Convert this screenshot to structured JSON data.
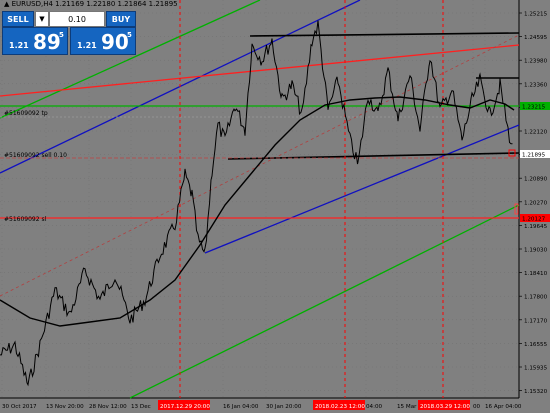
{
  "symbol_line": "EURUSD,H4  1.21169 1.22180 1.21864 1.21895",
  "trade_panel": {
    "sell_label": "SELL",
    "buy_label": "BUY",
    "lot_value": "0.10",
    "dropdown_icon": "chevron-down-icon",
    "sell_prefix": "1.21",
    "sell_big": "89",
    "sell_sup": "5",
    "buy_prefix": "1.21",
    "buy_big": "90",
    "buy_sup": "5"
  },
  "price_axis": {
    "labels": [
      "1.25215",
      "1.24595",
      "1.23980",
      "1.23360",
      "1.22745",
      "1.22120",
      "1.21505",
      "1.20890",
      "1.20270",
      "1.19645",
      "1.19030",
      "1.18410",
      "1.17800",
      "1.17170",
      "1.16555",
      "1.15935",
      "1.15320"
    ],
    "tags": [
      {
        "text": "1.23215",
        "color": "#00b000"
      },
      {
        "text": "1.21895",
        "color": "#ffffff"
      },
      {
        "text": "1.20127",
        "color": "#ff0000"
      }
    ]
  },
  "time_axis": {
    "labels": [
      "30 Oct 2017",
      "13 Nov 20:00",
      "28 Nov 12:00",
      "13 Dec",
      "16 Jan 04:00",
      "30 Jan 20:00",
      "04:00",
      "15 Mar",
      "00",
      "16 Apr 04:00"
    ],
    "highlights": [
      "2017.12.29 20:00",
      "2018.02.23 12:00",
      "2018.03.29 12:00"
    ]
  },
  "order_labels": [
    "#51609092 tp",
    "#51609092 sell 0.10",
    "#51609092 sl"
  ],
  "colors": {
    "background": "#808080",
    "candle": "#000000",
    "grid": "#6b6b6b",
    "tp_line": "#00b000",
    "sl_line": "#ff0000",
    "entry_line": "#ffffff",
    "vline": "#ff0000"
  }
}
